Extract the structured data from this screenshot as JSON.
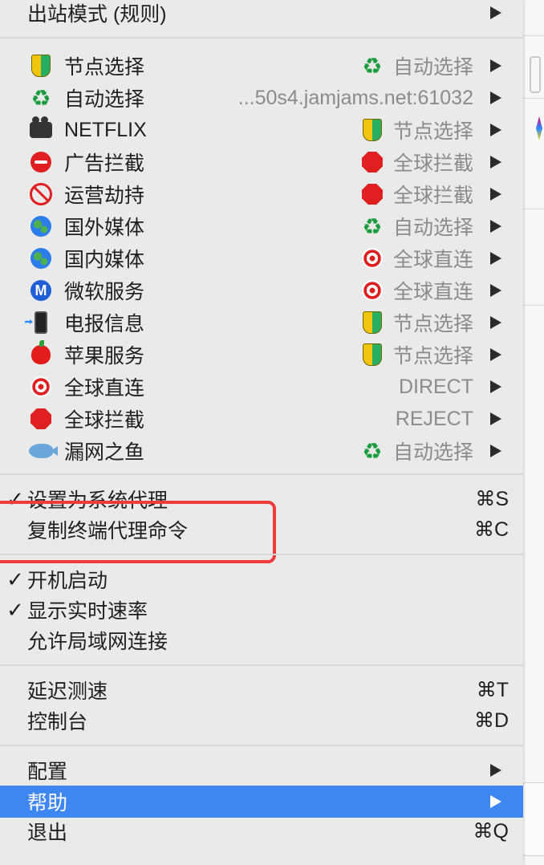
{
  "top": {
    "label": "出站模式 (规则)"
  },
  "proxy_groups": [
    {
      "label": "节点选择",
      "icon": "beginner-shield-icon",
      "value": "自动选择",
      "value_icon": "recycle-icon",
      "value_plain": false
    },
    {
      "label": "自动选择",
      "icon": "recycle-icon",
      "value": "...50s4.jamjams.net:61032",
      "value_icon": "",
      "value_plain": false
    },
    {
      "label": "NETFLIX",
      "icon": "movie-camera-icon",
      "value": "节点选择",
      "value_icon": "beginner-shield-icon",
      "value_plain": false
    },
    {
      "label": "广告拦截",
      "icon": "no-entry-icon",
      "value": "全球拦截",
      "value_icon": "stop-sign-icon",
      "value_plain": false
    },
    {
      "label": "运营劫持",
      "icon": "prohibited-icon",
      "value": "全球拦截",
      "value_icon": "stop-sign-icon",
      "value_plain": false
    },
    {
      "label": "国外媒体",
      "icon": "globe-icon",
      "value": "自动选择",
      "value_icon": "recycle-icon",
      "value_plain": false
    },
    {
      "label": "国内媒体",
      "icon": "globe-icon",
      "value": "全球直连",
      "value_icon": "direct-hit-icon",
      "value_plain": false
    },
    {
      "label": "微软服务",
      "icon": "circled-m-icon",
      "value": "全球直连",
      "value_icon": "direct-hit-icon",
      "value_plain": false
    },
    {
      "label": "电报信息",
      "icon": "mobile-arrow-icon",
      "value": "节点选择",
      "value_icon": "beginner-shield-icon",
      "value_plain": false
    },
    {
      "label": "苹果服务",
      "icon": "red-apple-icon",
      "value": "节点选择",
      "value_icon": "beginner-shield-icon",
      "value_plain": false
    },
    {
      "label": "全球直连",
      "icon": "direct-hit-icon",
      "value": "DIRECT",
      "value_icon": "",
      "value_plain": true
    },
    {
      "label": "全球拦截",
      "icon": "stop-sign-icon",
      "value": "REJECT",
      "value_icon": "",
      "value_plain": true
    },
    {
      "label": "漏网之鱼",
      "icon": "fish-icon",
      "value": "自动选择",
      "value_icon": "recycle-icon",
      "value_plain": false
    }
  ],
  "system": {
    "set_proxy": {
      "label": "设置为系统代理",
      "shortcut": "⌘S",
      "checked": true
    },
    "copy_cmd": {
      "label": "复制终端代理命令",
      "shortcut": "⌘C"
    }
  },
  "startup": {
    "launch": {
      "label": "开机启动",
      "checked": true
    },
    "speed": {
      "label": "显示实时速率",
      "checked": true
    },
    "lan": {
      "label": "允许局域网连接"
    }
  },
  "tools": {
    "latency": {
      "label": "延迟测速",
      "shortcut": "⌘T"
    },
    "console": {
      "label": "控制台",
      "shortcut": "⌘D"
    }
  },
  "footer": {
    "config": {
      "label": "配置"
    },
    "help": {
      "label": "帮助"
    },
    "quit": {
      "label": "退出",
      "shortcut": "⌘Q"
    }
  },
  "checkmark": "✓",
  "colors": {
    "highlight": "#3e87f3",
    "annotation_box": "#ef3b3b"
  }
}
